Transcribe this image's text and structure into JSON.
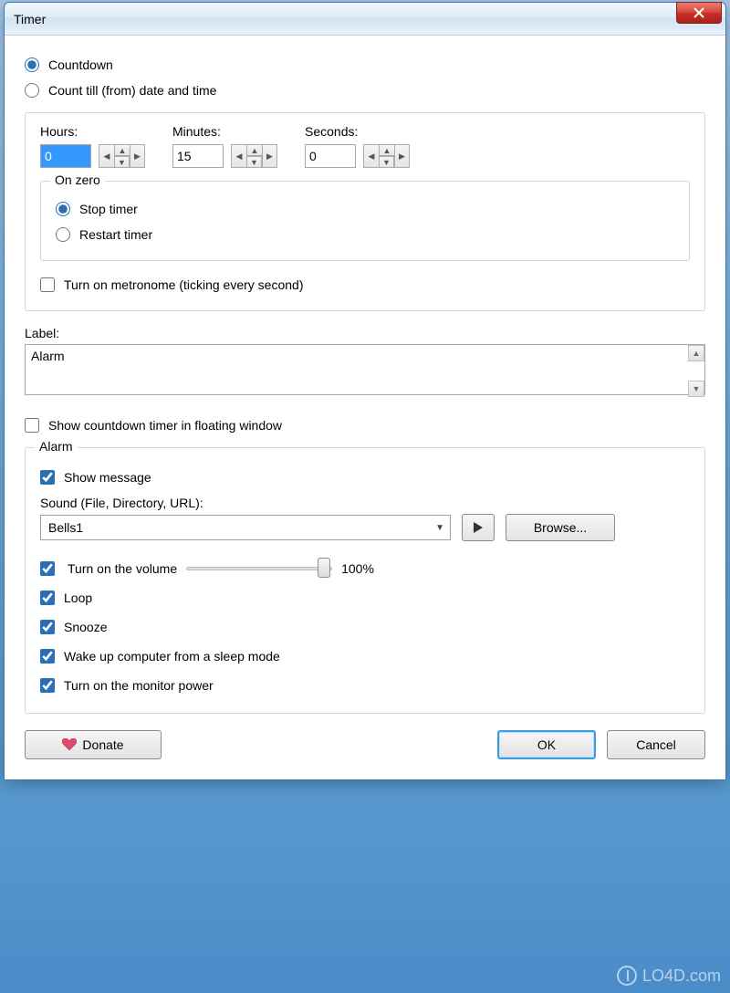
{
  "window": {
    "title": "Timer"
  },
  "mode": {
    "countdown_label": "Countdown",
    "count_till_label": "Count till (from) date and time"
  },
  "time": {
    "hours_label": "Hours:",
    "hours_value": "0",
    "minutes_label": "Minutes:",
    "minutes_value": "15",
    "seconds_label": "Seconds:",
    "seconds_value": "0"
  },
  "on_zero": {
    "legend": "On zero",
    "stop_label": "Stop timer",
    "restart_label": "Restart timer"
  },
  "metronome": {
    "label": "Turn on metronome (ticking every second)"
  },
  "label_field": {
    "caption": "Label:",
    "value": "Alarm"
  },
  "floating": {
    "label": "Show countdown timer in floating window"
  },
  "alarm": {
    "legend": "Alarm",
    "show_message_label": "Show message",
    "sound_caption": "Sound (File, Directory, URL):",
    "sound_value": "Bells1",
    "browse_label": "Browse...",
    "volume_label": "Turn on the volume",
    "volume_percent": "100%",
    "loop_label": "Loop",
    "snooze_label": "Snooze",
    "wake_label": "Wake up computer from a sleep mode",
    "monitor_label": "Turn on the monitor power"
  },
  "footer": {
    "donate_label": "Donate",
    "ok_label": "OK",
    "cancel_label": "Cancel"
  },
  "watermark": "LO4D.com"
}
